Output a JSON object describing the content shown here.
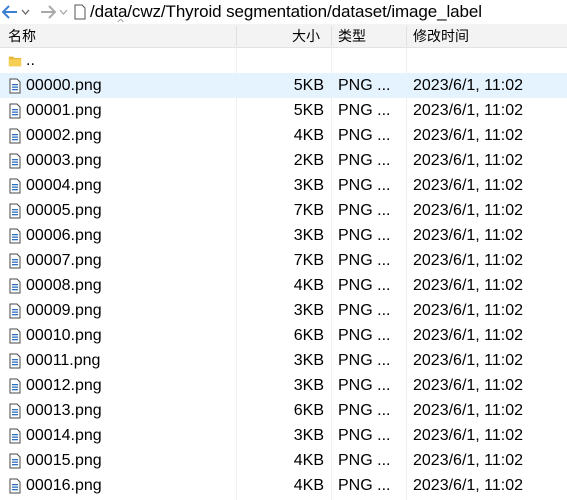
{
  "toolbar": {
    "back_icon": "arrow-left-icon",
    "forward_icon": "arrow-right-icon",
    "path": "/data/cwz/Thyroid segmentation/dataset/image_label"
  },
  "columns": {
    "name": "名称",
    "size": "大小",
    "type": "类型",
    "modified": "修改时间"
  },
  "parent_row": {
    "name": "..",
    "icon": "folder-icon"
  },
  "files": [
    {
      "name": "00000.png",
      "size": "5KB",
      "type": "PNG ...",
      "modified": "2023/6/1, 11:02"
    },
    {
      "name": "00001.png",
      "size": "5KB",
      "type": "PNG ...",
      "modified": "2023/6/1, 11:02"
    },
    {
      "name": "00002.png",
      "size": "4KB",
      "type": "PNG ...",
      "modified": "2023/6/1, 11:02"
    },
    {
      "name": "00003.png",
      "size": "2KB",
      "type": "PNG ...",
      "modified": "2023/6/1, 11:02"
    },
    {
      "name": "00004.png",
      "size": "3KB",
      "type": "PNG ...",
      "modified": "2023/6/1, 11:02"
    },
    {
      "name": "00005.png",
      "size": "7KB",
      "type": "PNG ...",
      "modified": "2023/6/1, 11:02"
    },
    {
      "name": "00006.png",
      "size": "3KB",
      "type": "PNG ...",
      "modified": "2023/6/1, 11:02"
    },
    {
      "name": "00007.png",
      "size": "7KB",
      "type": "PNG ...",
      "modified": "2023/6/1, 11:02"
    },
    {
      "name": "00008.png",
      "size": "4KB",
      "type": "PNG ...",
      "modified": "2023/6/1, 11:02"
    },
    {
      "name": "00009.png",
      "size": "3KB",
      "type": "PNG ...",
      "modified": "2023/6/1, 11:02"
    },
    {
      "name": "00010.png",
      "size": "6KB",
      "type": "PNG ...",
      "modified": "2023/6/1, 11:02"
    },
    {
      "name": "00011.png",
      "size": "3KB",
      "type": "PNG ...",
      "modified": "2023/6/1, 11:02"
    },
    {
      "name": "00012.png",
      "size": "3KB",
      "type": "PNG ...",
      "modified": "2023/6/1, 11:02"
    },
    {
      "name": "00013.png",
      "size": "6KB",
      "type": "PNG ...",
      "modified": "2023/6/1, 11:02"
    },
    {
      "name": "00014.png",
      "size": "3KB",
      "type": "PNG ...",
      "modified": "2023/6/1, 11:02"
    },
    {
      "name": "00015.png",
      "size": "4KB",
      "type": "PNG ...",
      "modified": "2023/6/1, 11:02"
    },
    {
      "name": "00016.png",
      "size": "4KB",
      "type": "PNG ...",
      "modified": "2023/6/1, 11:02"
    }
  ],
  "selected_index": 0,
  "colors": {
    "selection": "#e5f3ff",
    "header_bg": "#f3f3f3",
    "folder": "#e8b83a",
    "nav_arrow": "#3b7fd1"
  }
}
